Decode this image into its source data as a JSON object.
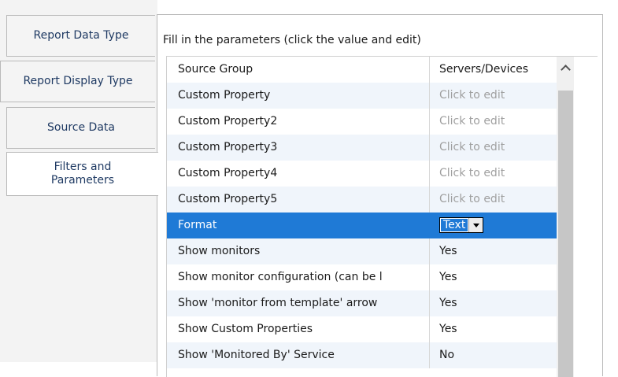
{
  "tabs": [
    {
      "label": "Report Data Type"
    },
    {
      "label": "Report Display Type"
    },
    {
      "label": "Source Data"
    },
    {
      "label": "Filters and Parameters"
    }
  ],
  "active_tab_index": 3,
  "instructions": "Fill in the parameters (click the value and edit)",
  "grid": {
    "rows": [
      {
        "name": "Source Group",
        "value": "Servers/Devices"
      },
      {
        "name": "Custom Property",
        "value": "Click to edit",
        "placeholder": true
      },
      {
        "name": "Custom Property2",
        "value": "Click to edit",
        "placeholder": true
      },
      {
        "name": "Custom Property3",
        "value": "Click to edit",
        "placeholder": true
      },
      {
        "name": "Custom Property4",
        "value": "Click to edit",
        "placeholder": true
      },
      {
        "name": "Custom Property5",
        "value": "Click to edit",
        "placeholder": true
      },
      {
        "name": "Format",
        "value": "Text",
        "selected": true,
        "dropdown": true
      },
      {
        "name": "Show monitors",
        "value": "Yes"
      },
      {
        "name": "Show monitor configuration (can be l",
        "value": "Yes"
      },
      {
        "name": "Show 'monitor from template' arrow",
        "value": "Yes"
      },
      {
        "name": "Show Custom Properties",
        "value": "Yes"
      },
      {
        "name": "Show 'Monitored By' Service",
        "value": "No"
      }
    ]
  },
  "colors": {
    "selection": "#1f7ad6",
    "alt_row": "#f0f5fb",
    "tab_text": "#1f3a63",
    "placeholder_text": "#a0a0a0"
  },
  "icons": {
    "scroll_up": "chevron-up-icon",
    "dropdown": "dropdown-arrow-icon"
  }
}
